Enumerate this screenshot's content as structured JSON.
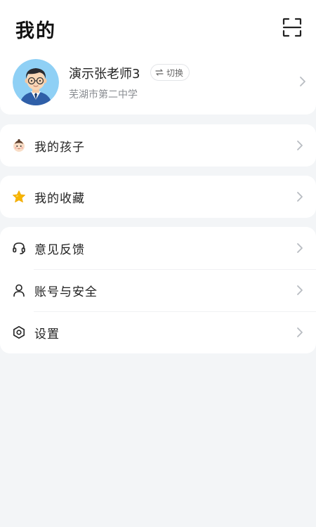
{
  "header": {
    "title": "我的",
    "scan_icon": "scan-icon"
  },
  "profile": {
    "name": "演示张老师3",
    "switch_label": "切换",
    "school": "芜湖市第二中学",
    "avatar_icon": "teacher-avatar"
  },
  "menu_groups": [
    {
      "items": [
        {
          "label": "我的孩子",
          "icon": "child-face-icon"
        }
      ]
    },
    {
      "items": [
        {
          "label": "我的收藏",
          "icon": "star-icon"
        }
      ]
    },
    {
      "items": [
        {
          "label": "意见反馈",
          "icon": "headset-icon"
        },
        {
          "label": "账号与安全",
          "icon": "person-icon"
        },
        {
          "label": "设置",
          "icon": "settings-hexagon-icon"
        }
      ]
    }
  ],
  "colors": {
    "background": "#f3f5f7",
    "card": "#ffffff",
    "star": "#f7b500",
    "avatar_bg": "#8fd0f5",
    "chevron": "#b8bcc2"
  }
}
